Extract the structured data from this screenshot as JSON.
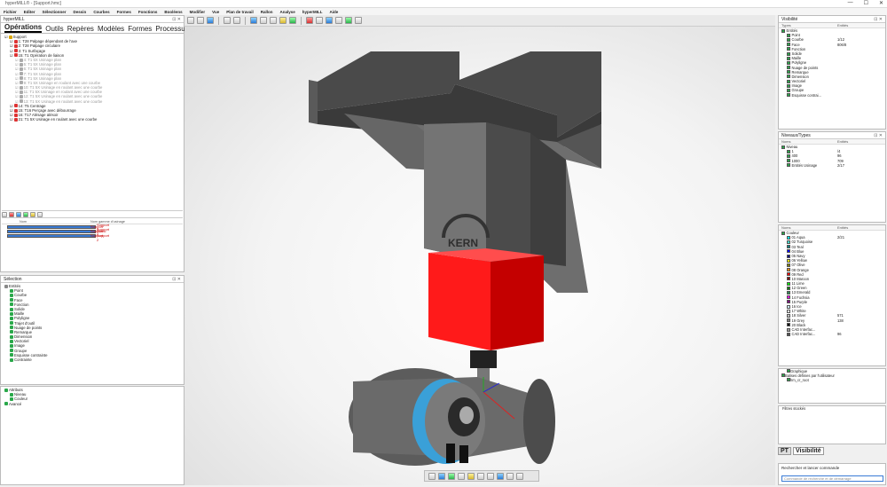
{
  "window": {
    "title": "hyperMILL® - [Support.hmc]",
    "controls": [
      "—",
      "☐",
      "✕"
    ]
  },
  "menu": [
    "Fichier",
    "Editer",
    "Sélectionner",
    "Dessin",
    "Courbes",
    "Formes",
    "Fonctions",
    "Booléens",
    "Modifier",
    "Vue",
    "Plan de travail",
    "Rallon",
    "Analyse",
    "hyperMILL",
    "Aide"
  ],
  "left": {
    "panel_title": "hyperMILL",
    "tabs": [
      "Opérations",
      "Outils",
      "Repères",
      "Modèles",
      "Formes",
      "Processus"
    ],
    "operations": [
      {
        "label": "Support",
        "level": 0,
        "dis": false,
        "c": "#d9a400"
      },
      {
        "label": "1: T28 Palpage dépendant de l'axe",
        "level": 1,
        "dis": false,
        "c": "#d33"
      },
      {
        "label": "2: T28 Palpage circulaire",
        "level": 1,
        "dis": false,
        "c": "#d33"
      },
      {
        "label": "3: T1 Surfaçage",
        "level": 1,
        "dis": false,
        "c": "#d33"
      },
      {
        "label": "15: T1 Opération de liaison",
        "level": 1,
        "dis": false,
        "c": "#d33"
      },
      {
        "label": "4: T1 5X Usinage plan",
        "level": 2,
        "dis": true,
        "c": "#aaa"
      },
      {
        "label": "5: T1 5X Usinage plan",
        "level": 2,
        "dis": true,
        "c": "#aaa"
      },
      {
        "label": "6: T1 5X Usinage plan",
        "level": 2,
        "dis": true,
        "c": "#aaa"
      },
      {
        "label": "7: T1 5X Usinage plan",
        "level": 2,
        "dis": true,
        "c": "#aaa"
      },
      {
        "label": "8: T1 5X Usinage plan",
        "level": 2,
        "dis": true,
        "c": "#aaa"
      },
      {
        "label": "9: T1 5X Usinage en roulant avec une courbe",
        "level": 2,
        "dis": true,
        "c": "#aaa"
      },
      {
        "label": "10: T1 5X Usinage en roulant avec une courbe",
        "level": 2,
        "dis": true,
        "c": "#aaa"
      },
      {
        "label": "11: T1 5X Usinage en roulant avec une courbe",
        "level": 2,
        "dis": true,
        "c": "#aaa"
      },
      {
        "label": "12: T1 5X Usinage en roulant avec une courbe",
        "level": 2,
        "dis": true,
        "c": "#aaa"
      },
      {
        "label": "13: T1 5X Usinage en roulant avec une courbe",
        "level": 2,
        "dis": true,
        "c": "#aaa"
      },
      {
        "label": "14: T5 Centrage",
        "level": 1,
        "dis": false,
        "c": "#d33"
      },
      {
        "label": "15: T16 Perçage avec débourrage",
        "level": 1,
        "dis": false,
        "c": "#d33"
      },
      {
        "label": "16: T17 Alésage alésoir",
        "level": 1,
        "dis": false,
        "c": "#d33"
      },
      {
        "label": "21: T1 5X Usinage en roulant avec une courbe",
        "level": 1,
        "dis": false,
        "c": "#d33"
      }
    ],
    "stock_headers": [
      "Nom",
      "Nom gamme d'usinage"
    ],
    "stock_rows": [
      {
        "name": "Support 3",
        "job": "Support"
      },
      {
        "name": "Support 2",
        "job": "Support"
      },
      {
        "name": "Stock: Support 2",
        "job": "Support"
      }
    ],
    "selection_title": "Sélection",
    "selection_items": [
      "Entités",
      "Point",
      "Courbe",
      "Face",
      "Fonction",
      "Solide",
      "Maille",
      "Polyligne",
      "Trajet d'outil",
      "Nuage de points",
      "Remarque",
      "Dimension",
      "Vectoriel",
      "Image",
      "Groupe",
      "Esquisse contrainte",
      "Contrainte"
    ],
    "attr_items": [
      "Attributs",
      "Niveau",
      "Couleur",
      "Avancé"
    ]
  },
  "right": {
    "vis_title": "Visibilité",
    "vis_headers": [
      "Types",
      "Entités"
    ],
    "vis_items": [
      {
        "n": "Entités",
        "v": ""
      },
      {
        "n": "Point",
        "v": ""
      },
      {
        "n": "Courbe",
        "v": "1/12"
      },
      {
        "n": "Face",
        "v": "806/8"
      },
      {
        "n": "Fonction",
        "v": ""
      },
      {
        "n": "Solide",
        "v": ""
      },
      {
        "n": "Maille",
        "v": ""
      },
      {
        "n": "Polyligne",
        "v": ""
      },
      {
        "n": "Nuage de points",
        "v": ""
      },
      {
        "n": "Remarque",
        "v": ""
      },
      {
        "n": "Dimension",
        "v": ""
      },
      {
        "n": "Vectoriel",
        "v": ""
      },
      {
        "n": "Image",
        "v": ""
      },
      {
        "n": "Groupe",
        "v": ""
      },
      {
        "n": "Esquisse contrai...",
        "v": ""
      }
    ],
    "level_title": "Niveaux/Types",
    "level_headers": [
      "Noms",
      "Entités"
    ],
    "level_items": [
      {
        "n": "Niveau",
        "v": ""
      },
      {
        "n": "1",
        "v": "/4"
      },
      {
        "n": "400",
        "v": "96"
      },
      {
        "n": "1000",
        "v": "709"
      },
      {
        "n": "Entités Usinage",
        "v": "2/17"
      }
    ],
    "color_headers": [
      "Noms",
      "Entités"
    ],
    "color_items": [
      {
        "n": "Couleur",
        "v": "",
        "c": ""
      },
      {
        "n": "01 Aqua",
        "v": "2/21",
        "c": "#00ffff"
      },
      {
        "n": "02 Turquoise",
        "v": "",
        "c": "#40e0d0"
      },
      {
        "n": "03 Teal",
        "v": "",
        "c": "#008080"
      },
      {
        "n": "04 Blue",
        "v": "",
        "c": "#0000ff"
      },
      {
        "n": "05 Navy",
        "v": "",
        "c": "#000080"
      },
      {
        "n": "06 Yellow",
        "v": "",
        "c": "#ffff00"
      },
      {
        "n": "07 Olive",
        "v": "",
        "c": "#808000"
      },
      {
        "n": "08 Orange",
        "v": "",
        "c": "#ff8c00"
      },
      {
        "n": "09 Red",
        "v": "",
        "c": "#ff0000"
      },
      {
        "n": "10 Maroon",
        "v": "",
        "c": "#800000"
      },
      {
        "n": "11 Lime",
        "v": "",
        "c": "#00ff00"
      },
      {
        "n": "12 Green",
        "v": "",
        "c": "#008000"
      },
      {
        "n": "13 Emerald",
        "v": "",
        "c": "#2e8b57"
      },
      {
        "n": "14 Fuchsia",
        "v": "",
        "c": "#ff00ff"
      },
      {
        "n": "15 Purple",
        "v": "",
        "c": "#800080"
      },
      {
        "n": "16 Ice",
        "v": "",
        "c": "#d0f0ff"
      },
      {
        "n": "17 White",
        "v": "",
        "c": "#ffffff"
      },
      {
        "n": "18 Silver",
        "v": "571",
        "c": "#c0c0c0"
      },
      {
        "n": "19 Grey",
        "v": "138",
        "c": "#808080"
      },
      {
        "n": "20 Black",
        "v": "",
        "c": "#000000"
      },
      {
        "n": "CAD Interfac...",
        "v": "",
        "c": "#999999"
      },
      {
        "n": "CAD Interfac...",
        "v": "96",
        "c": "#555555"
      }
    ],
    "obj_items": [
      "Graphique",
      "Balises définies par l'utilisateur",
      "hm_cr_root"
    ],
    "filter_label": "Filtres stockés",
    "tabs": [
      "PT",
      "Visibilité"
    ],
    "search_label": "Rechercher et lancer commande",
    "search_placeholder": "Commande de recherche et de démarrage"
  },
  "model": {
    "brand": "KERN",
    "head_color": "#ee1111",
    "body_color": "#6b6b6b",
    "disk_color": "#3aa0d8"
  }
}
